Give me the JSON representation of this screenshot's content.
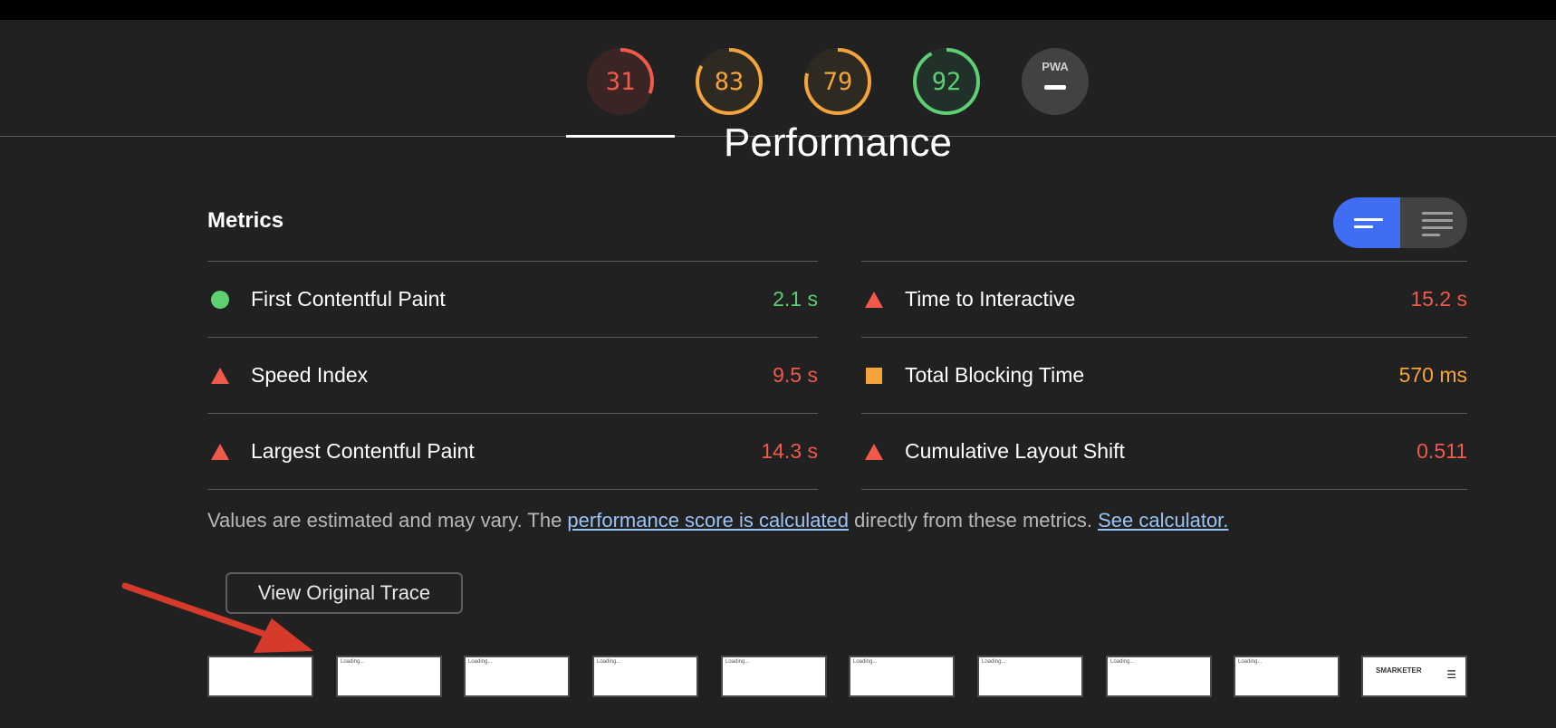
{
  "colors": {
    "fail": "#f05a4a",
    "average": "#f5a43c",
    "pass": "#5fcf73",
    "link": "#99c4f5",
    "accent": "#3f6ef4"
  },
  "gauges": [
    {
      "value": "31",
      "score": 31,
      "color": "#f05a4a",
      "bg": "#3a2524"
    },
    {
      "value": "83",
      "score": 83,
      "color": "#f5a43c",
      "bg": "#2e2a22"
    },
    {
      "value": "79",
      "score": 79,
      "color": "#f5a43c",
      "bg": "#2e2a22"
    },
    {
      "value": "92",
      "score": 92,
      "color": "#5fcf73",
      "bg": "#22302a"
    }
  ],
  "pwa": {
    "label": "PWA",
    "icon": "dash-icon"
  },
  "section": {
    "title": "Performance"
  },
  "metrics": {
    "title": "Metrics",
    "toggle": {
      "left_icon": "compact-view-icon",
      "right_icon": "expanded-view-icon"
    },
    "left": [
      {
        "icon": "pass-circle-icon",
        "label": "First Contentful Paint",
        "value": "2.1 s",
        "status": "pass"
      },
      {
        "icon": "fail-triangle-icon",
        "label": "Speed Index",
        "value": "9.5 s",
        "status": "fail"
      },
      {
        "icon": "fail-triangle-icon",
        "label": "Largest Contentful Paint",
        "value": "14.3 s",
        "status": "fail"
      }
    ],
    "right": [
      {
        "icon": "fail-triangle-icon",
        "label": "Time to Interactive",
        "value": "15.2 s",
        "status": "fail"
      },
      {
        "icon": "average-square-icon",
        "label": "Total Blocking Time",
        "value": "570 ms",
        "status": "average"
      },
      {
        "icon": "fail-triangle-icon",
        "label": "Cumulative Layout Shift",
        "value": "0.511",
        "status": "fail"
      }
    ]
  },
  "footnote": {
    "text1": "Values are estimated and may vary. The ",
    "link1": "performance score is calculated",
    "text2": " directly from these metrics. ",
    "link2": "See calculator."
  },
  "trace_button": "View Original Trace",
  "filmstrip": {
    "frames": [
      "",
      "Loading...",
      "Loading...",
      "Loading...",
      "Loading...",
      "Loading...",
      "Loading...",
      "Loading...",
      "Loading...",
      "SMARKETER"
    ]
  }
}
